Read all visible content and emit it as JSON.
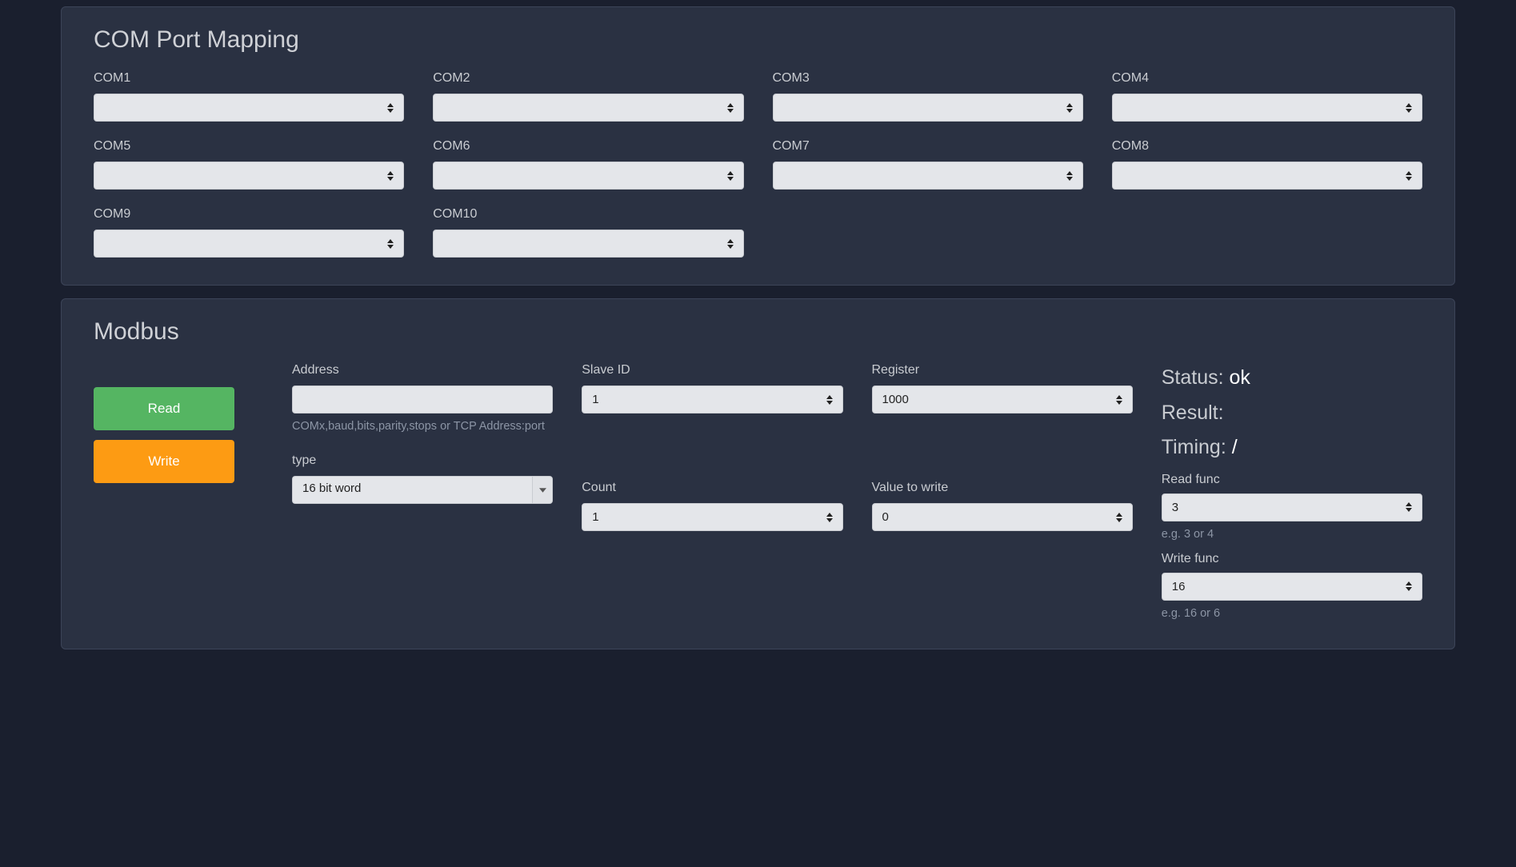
{
  "com_section": {
    "title": "COM Port Mapping",
    "ports": [
      {
        "label": "COM1",
        "value": ""
      },
      {
        "label": "COM2",
        "value": ""
      },
      {
        "label": "COM3",
        "value": ""
      },
      {
        "label": "COM4",
        "value": ""
      },
      {
        "label": "COM5",
        "value": ""
      },
      {
        "label": "COM6",
        "value": ""
      },
      {
        "label": "COM7",
        "value": ""
      },
      {
        "label": "COM8",
        "value": ""
      },
      {
        "label": "COM9",
        "value": ""
      },
      {
        "label": "COM10",
        "value": ""
      }
    ]
  },
  "modbus": {
    "title": "Modbus",
    "buttons": {
      "read": "Read",
      "write": "Write"
    },
    "fields": {
      "address": {
        "label": "Address",
        "value": "",
        "help": "COMx,baud,bits,parity,stops or TCP Address:port"
      },
      "slave_id": {
        "label": "Slave ID",
        "value": "1"
      },
      "register": {
        "label": "Register",
        "value": "1000"
      },
      "type": {
        "label": "type",
        "value": "16 bit word"
      },
      "count": {
        "label": "Count",
        "value": "1"
      },
      "value_to_write": {
        "label": "Value to write",
        "value": "0"
      }
    },
    "status": {
      "status_label": "Status:",
      "status_value": "ok",
      "result_label": "Result:",
      "result_value": "",
      "timing_label": "Timing:",
      "timing_value": "/"
    },
    "funcs": {
      "read_func": {
        "label": "Read func",
        "value": "3",
        "help": "e.g. 3 or 4"
      },
      "write_func": {
        "label": "Write func",
        "value": "16",
        "help": "e.g. 16 or 6"
      }
    }
  }
}
